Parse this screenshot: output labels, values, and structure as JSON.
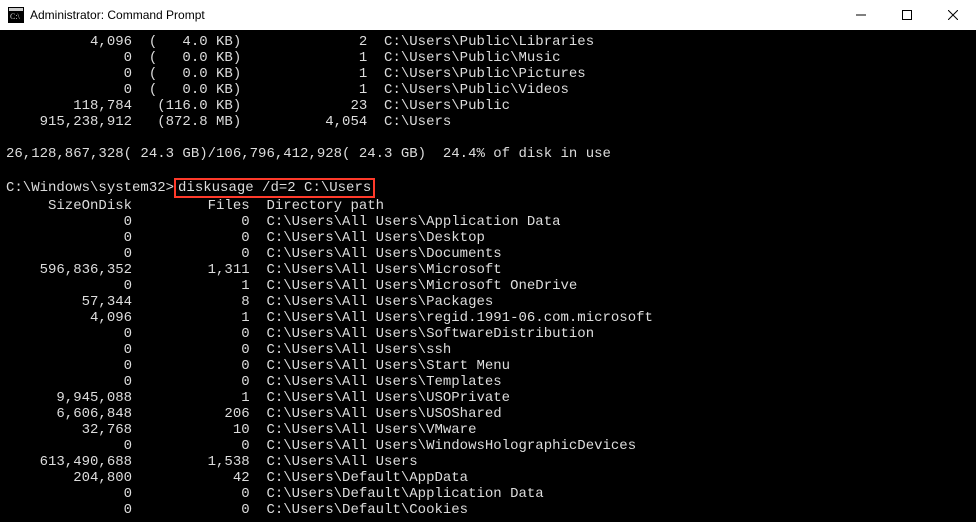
{
  "window": {
    "title": "Administrator: Command Prompt"
  },
  "top_rows": [
    {
      "size": "4,096",
      "hr": "(   4.0 KB)",
      "files": "2",
      "path": "C:\\Users\\Public\\Libraries"
    },
    {
      "size": "0",
      "hr": "(   0.0 KB)",
      "files": "1",
      "path": "C:\\Users\\Public\\Music"
    },
    {
      "size": "0",
      "hr": "(   0.0 KB)",
      "files": "1",
      "path": "C:\\Users\\Public\\Pictures"
    },
    {
      "size": "0",
      "hr": "(   0.0 KB)",
      "files": "1",
      "path": "C:\\Users\\Public\\Videos"
    },
    {
      "size": "118,784",
      "hr": "(116.0 KB)",
      "files": "23",
      "path": "C:\\Users\\Public"
    },
    {
      "size": "915,238,912",
      "hr": "(872.8 MB)",
      "files": "4,054",
      "path": "C:\\Users"
    }
  ],
  "summary": "26,128,867,328( 24.3 GB)/106,796,412,928( 24.3 GB)  24.4% of disk in use",
  "prompt": {
    "path": "C:\\Windows\\system32>",
    "command": "diskusage /d=2 C:\\Users"
  },
  "header": {
    "col1": "SizeOnDisk",
    "col2": "Files",
    "col3": "Directory path"
  },
  "rows": [
    {
      "size": "0",
      "files": "0",
      "path": "C:\\Users\\All Users\\Application Data"
    },
    {
      "size": "0",
      "files": "0",
      "path": "C:\\Users\\All Users\\Desktop"
    },
    {
      "size": "0",
      "files": "0",
      "path": "C:\\Users\\All Users\\Documents"
    },
    {
      "size": "596,836,352",
      "files": "1,311",
      "path": "C:\\Users\\All Users\\Microsoft"
    },
    {
      "size": "0",
      "files": "1",
      "path": "C:\\Users\\All Users\\Microsoft OneDrive"
    },
    {
      "size": "57,344",
      "files": "8",
      "path": "C:\\Users\\All Users\\Packages"
    },
    {
      "size": "4,096",
      "files": "1",
      "path": "C:\\Users\\All Users\\regid.1991-06.com.microsoft"
    },
    {
      "size": "0",
      "files": "0",
      "path": "C:\\Users\\All Users\\SoftwareDistribution"
    },
    {
      "size": "0",
      "files": "0",
      "path": "C:\\Users\\All Users\\ssh"
    },
    {
      "size": "0",
      "files": "0",
      "path": "C:\\Users\\All Users\\Start Menu"
    },
    {
      "size": "0",
      "files": "0",
      "path": "C:\\Users\\All Users\\Templates"
    },
    {
      "size": "9,945,088",
      "files": "1",
      "path": "C:\\Users\\All Users\\USOPrivate"
    },
    {
      "size": "6,606,848",
      "files": "206",
      "path": "C:\\Users\\All Users\\USOShared"
    },
    {
      "size": "32,768",
      "files": "10",
      "path": "C:\\Users\\All Users\\VMware"
    },
    {
      "size": "0",
      "files": "0",
      "path": "C:\\Users\\All Users\\WindowsHolographicDevices"
    },
    {
      "size": "613,490,688",
      "files": "1,538",
      "path": "C:\\Users\\All Users"
    },
    {
      "size": "204,800",
      "files": "42",
      "path": "C:\\Users\\Default\\AppData"
    },
    {
      "size": "0",
      "files": "0",
      "path": "C:\\Users\\Default\\Application Data"
    },
    {
      "size": "0",
      "files": "0",
      "path": "C:\\Users\\Default\\Cookies"
    }
  ]
}
